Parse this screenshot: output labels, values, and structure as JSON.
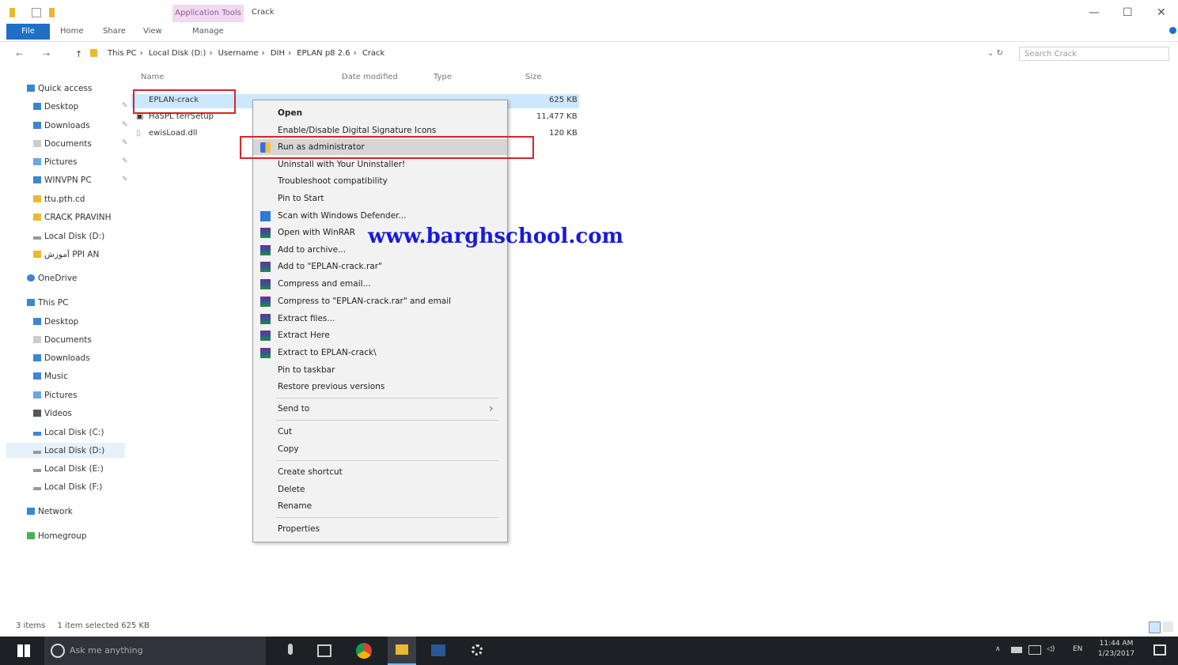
{
  "window": {
    "context_tab": "Application Tools",
    "title": "Crack",
    "minimize": "—",
    "maximize": "☐",
    "close": "✕"
  },
  "ribbon": {
    "file": "File",
    "home": "Home",
    "share": "Share",
    "view": "View",
    "manage": "Manage"
  },
  "address": {
    "back": "←",
    "forward": "→",
    "up": "↑",
    "crumbs": [
      "This PC",
      "Local Disk (D:)",
      "Username",
      "DIH",
      "EPLAN p8 2.6",
      "Crack"
    ],
    "search_placeholder": "Search Crack"
  },
  "nav": {
    "quick_access": "Quick access",
    "items": [
      {
        "label": "Desktop",
        "pinned": true
      },
      {
        "label": "Downloads",
        "pinned": true
      },
      {
        "label": "Documents",
        "pinned": true
      },
      {
        "label": "Pictures",
        "pinned": true
      },
      {
        "label": "WINVPN PC",
        "pinned": true
      },
      {
        "label": "ttu.pth.cd",
        "pinned": false
      },
      {
        "label": "CRACK PRAVINH",
        "pinned": false
      },
      {
        "label": "Local Disk (D:)",
        "pinned": false
      },
      {
        "label": "آموزش PPI AN",
        "pinned": false
      }
    ],
    "onedrive": "OneDrive",
    "this_pc": "This PC",
    "pc_items": [
      "Desktop",
      "Documents",
      "Downloads",
      "Music",
      "Pictures",
      "Videos",
      "Local Disk (C:)",
      "Local Disk (D:)",
      "Local Disk (E:)",
      "Local Disk (F:)"
    ],
    "network": "Network",
    "homegroup": "Homegroup"
  },
  "columns": {
    "name": "Name",
    "date": "Date modified",
    "type": "Type",
    "size": "Size"
  },
  "files": [
    {
      "name": "EPLAN-crack",
      "size": "625 KB"
    },
    {
      "name": "HaSPL terrSetup",
      "size": "11,477 KB"
    },
    {
      "name": "ewisLoad.dll",
      "size": "120 KB"
    }
  ],
  "context_menu": {
    "open": "Open",
    "digital_sig": "Enable/Disable Digital Signature Icons",
    "run_admin": "Run as administrator",
    "uninstall": "Uninstall with Your Uninstaller!",
    "troubleshoot": "Troubleshoot compatibility",
    "pin_start": "Pin to Start",
    "defender": "Scan with Windows Defender...",
    "open_winrar": "Open with WinRAR",
    "add_archive": "Add to archive...",
    "add_named": "Add to \"EPLAN-crack.rar\"",
    "compress_email": "Compress and email...",
    "compress_named_email": "Compress to \"EPLAN-crack.rar\" and email",
    "extract_files": "Extract files...",
    "extract_here": "Extract Here",
    "extract_to": "Extract to EPLAN-crack\\",
    "pin_taskbar": "Pin to taskbar",
    "restore": "Restore previous versions",
    "send_to": "Send to",
    "cut": "Cut",
    "copy": "Copy",
    "create_shortcut": "Create shortcut",
    "delete": "Delete",
    "rename": "Rename",
    "properties": "Properties"
  },
  "watermark": "www.barghschool.com",
  "status": {
    "items": "3 items",
    "selected": "1 item selected  625 KB"
  },
  "taskbar": {
    "search": "Ask me anything",
    "time": "11:44 AM",
    "date": "1/23/2017",
    "lang": "EN"
  },
  "colors": {
    "accent": "#1e6fc7",
    "highlight": "#d6242a",
    "watermark": "#1a1ad8",
    "selection": "#cce8ff"
  }
}
